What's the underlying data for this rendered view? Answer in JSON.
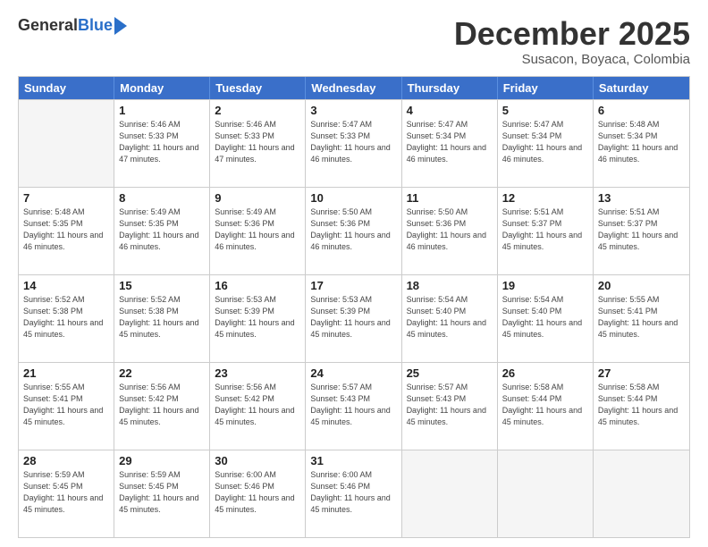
{
  "header": {
    "logo_general": "General",
    "logo_blue": "Blue",
    "month_title": "December 2025",
    "subtitle": "Susacon, Boyaca, Colombia"
  },
  "days_of_week": [
    "Sunday",
    "Monday",
    "Tuesday",
    "Wednesday",
    "Thursday",
    "Friday",
    "Saturday"
  ],
  "weeks": [
    [
      {
        "day": "",
        "empty": true
      },
      {
        "day": "1",
        "sunrise": "5:46 AM",
        "sunset": "5:33 PM",
        "daylight": "11 hours and 47 minutes."
      },
      {
        "day": "2",
        "sunrise": "5:46 AM",
        "sunset": "5:33 PM",
        "daylight": "11 hours and 47 minutes."
      },
      {
        "day": "3",
        "sunrise": "5:47 AM",
        "sunset": "5:33 PM",
        "daylight": "11 hours and 46 minutes."
      },
      {
        "day": "4",
        "sunrise": "5:47 AM",
        "sunset": "5:34 PM",
        "daylight": "11 hours and 46 minutes."
      },
      {
        "day": "5",
        "sunrise": "5:47 AM",
        "sunset": "5:34 PM",
        "daylight": "11 hours and 46 minutes."
      },
      {
        "day": "6",
        "sunrise": "5:48 AM",
        "sunset": "5:34 PM",
        "daylight": "11 hours and 46 minutes."
      }
    ],
    [
      {
        "day": "7",
        "sunrise": "5:48 AM",
        "sunset": "5:35 PM",
        "daylight": "11 hours and 46 minutes."
      },
      {
        "day": "8",
        "sunrise": "5:49 AM",
        "sunset": "5:35 PM",
        "daylight": "11 hours and 46 minutes."
      },
      {
        "day": "9",
        "sunrise": "5:49 AM",
        "sunset": "5:36 PM",
        "daylight": "11 hours and 46 minutes."
      },
      {
        "day": "10",
        "sunrise": "5:50 AM",
        "sunset": "5:36 PM",
        "daylight": "11 hours and 46 minutes."
      },
      {
        "day": "11",
        "sunrise": "5:50 AM",
        "sunset": "5:36 PM",
        "daylight": "11 hours and 46 minutes."
      },
      {
        "day": "12",
        "sunrise": "5:51 AM",
        "sunset": "5:37 PM",
        "daylight": "11 hours and 45 minutes."
      },
      {
        "day": "13",
        "sunrise": "5:51 AM",
        "sunset": "5:37 PM",
        "daylight": "11 hours and 45 minutes."
      }
    ],
    [
      {
        "day": "14",
        "sunrise": "5:52 AM",
        "sunset": "5:38 PM",
        "daylight": "11 hours and 45 minutes."
      },
      {
        "day": "15",
        "sunrise": "5:52 AM",
        "sunset": "5:38 PM",
        "daylight": "11 hours and 45 minutes."
      },
      {
        "day": "16",
        "sunrise": "5:53 AM",
        "sunset": "5:39 PM",
        "daylight": "11 hours and 45 minutes."
      },
      {
        "day": "17",
        "sunrise": "5:53 AM",
        "sunset": "5:39 PM",
        "daylight": "11 hours and 45 minutes."
      },
      {
        "day": "18",
        "sunrise": "5:54 AM",
        "sunset": "5:40 PM",
        "daylight": "11 hours and 45 minutes."
      },
      {
        "day": "19",
        "sunrise": "5:54 AM",
        "sunset": "5:40 PM",
        "daylight": "11 hours and 45 minutes."
      },
      {
        "day": "20",
        "sunrise": "5:55 AM",
        "sunset": "5:41 PM",
        "daylight": "11 hours and 45 minutes."
      }
    ],
    [
      {
        "day": "21",
        "sunrise": "5:55 AM",
        "sunset": "5:41 PM",
        "daylight": "11 hours and 45 minutes."
      },
      {
        "day": "22",
        "sunrise": "5:56 AM",
        "sunset": "5:42 PM",
        "daylight": "11 hours and 45 minutes."
      },
      {
        "day": "23",
        "sunrise": "5:56 AM",
        "sunset": "5:42 PM",
        "daylight": "11 hours and 45 minutes."
      },
      {
        "day": "24",
        "sunrise": "5:57 AM",
        "sunset": "5:43 PM",
        "daylight": "11 hours and 45 minutes."
      },
      {
        "day": "25",
        "sunrise": "5:57 AM",
        "sunset": "5:43 PM",
        "daylight": "11 hours and 45 minutes."
      },
      {
        "day": "26",
        "sunrise": "5:58 AM",
        "sunset": "5:44 PM",
        "daylight": "11 hours and 45 minutes."
      },
      {
        "day": "27",
        "sunrise": "5:58 AM",
        "sunset": "5:44 PM",
        "daylight": "11 hours and 45 minutes."
      }
    ],
    [
      {
        "day": "28",
        "sunrise": "5:59 AM",
        "sunset": "5:45 PM",
        "daylight": "11 hours and 45 minutes."
      },
      {
        "day": "29",
        "sunrise": "5:59 AM",
        "sunset": "5:45 PM",
        "daylight": "11 hours and 45 minutes."
      },
      {
        "day": "30",
        "sunrise": "6:00 AM",
        "sunset": "5:46 PM",
        "daylight": "11 hours and 45 minutes."
      },
      {
        "day": "31",
        "sunrise": "6:00 AM",
        "sunset": "5:46 PM",
        "daylight": "11 hours and 45 minutes."
      },
      {
        "day": "",
        "empty": true
      },
      {
        "day": "",
        "empty": true
      },
      {
        "day": "",
        "empty": true
      }
    ]
  ]
}
